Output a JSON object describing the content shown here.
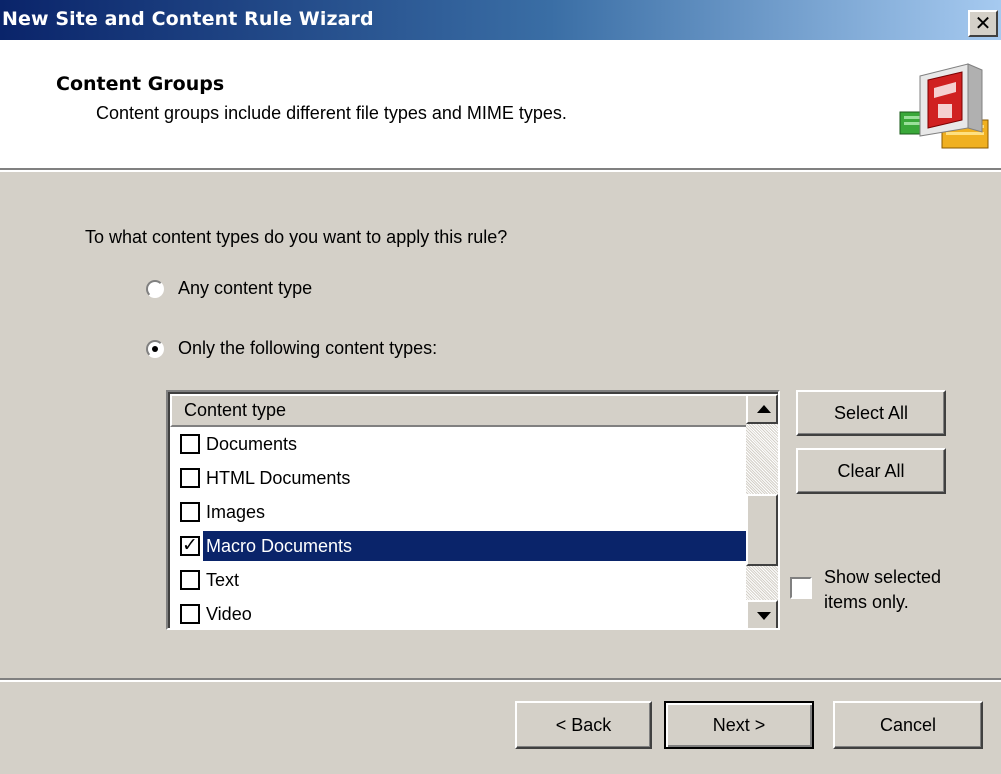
{
  "window": {
    "title": "New Site and Content Rule Wizard",
    "close_label": "✕"
  },
  "header": {
    "title": "Content Groups",
    "subtitle": "Content groups include different file types and MIME types."
  },
  "question": "To what content types do you want to apply this rule?",
  "options": {
    "any": {
      "label": "Any content type",
      "selected": false
    },
    "only": {
      "label": "Only the following content types:",
      "selected": true
    }
  },
  "list": {
    "column_header": "Content type",
    "items": [
      {
        "label": "Documents",
        "checked": false,
        "selected": false
      },
      {
        "label": "HTML Documents",
        "checked": false,
        "selected": false
      },
      {
        "label": "Images",
        "checked": false,
        "selected": false
      },
      {
        "label": "Macro Documents",
        "checked": true,
        "selected": true
      },
      {
        "label": "Text",
        "checked": false,
        "selected": false
      },
      {
        "label": "Video",
        "checked": false,
        "selected": false
      }
    ]
  },
  "side_buttons": {
    "select_all": "Select All",
    "clear_all": "Clear All"
  },
  "show_selected": {
    "label": "Show selected items only.",
    "checked": false
  },
  "footer": {
    "back": "< Back",
    "next": "Next >",
    "cancel": "Cancel"
  }
}
